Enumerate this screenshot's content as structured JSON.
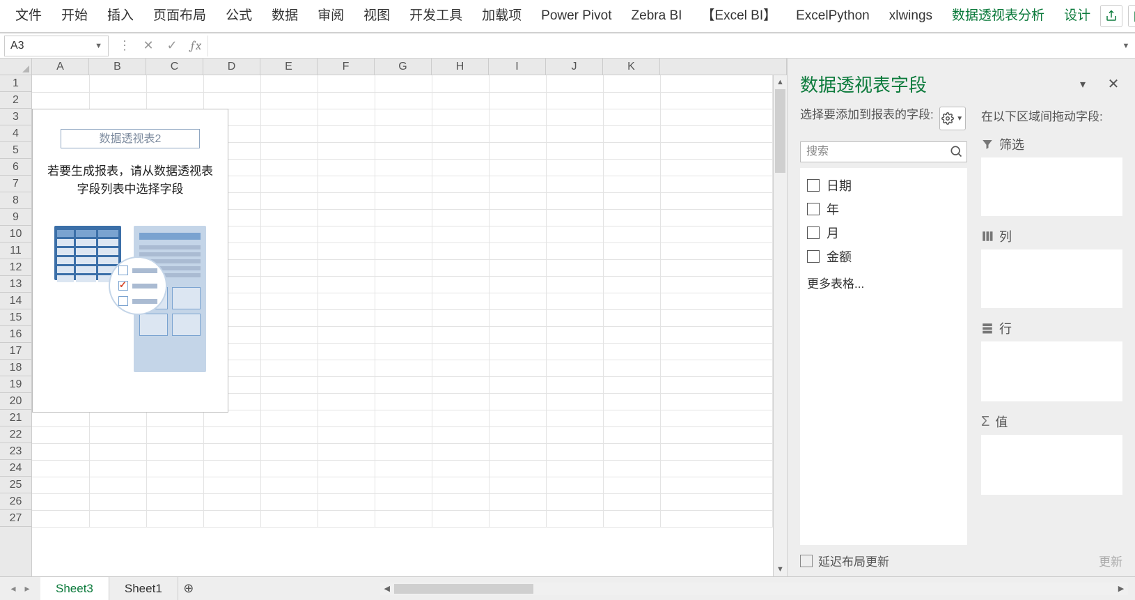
{
  "ribbon": {
    "tabs": [
      "文件",
      "开始",
      "插入",
      "页面布局",
      "公式",
      "数据",
      "审阅",
      "视图",
      "开发工具",
      "加载项",
      "Power Pivot",
      "Zebra BI",
      "【Excel BI】",
      "ExcelPython",
      "xlwings"
    ],
    "context_tabs": [
      "数据透视表分析",
      "设计"
    ]
  },
  "formula_bar": {
    "name_box": "A3",
    "value": ""
  },
  "grid": {
    "columns": [
      "A",
      "B",
      "C",
      "D",
      "E",
      "F",
      "G",
      "H",
      "I",
      "J",
      "K"
    ],
    "rows": [
      "1",
      "2",
      "3",
      "4",
      "5",
      "6",
      "7",
      "8",
      "9",
      "10",
      "11",
      "12",
      "13",
      "14",
      "15",
      "16",
      "17",
      "18",
      "19",
      "20",
      "21",
      "22",
      "23",
      "24",
      "25",
      "26",
      "27"
    ]
  },
  "pivot_placeholder": {
    "title": "数据透视表2",
    "hint_line1": "若要生成报表，请从数据透视表",
    "hint_line2": "字段列表中选择字段"
  },
  "panel": {
    "title": "数据透视表字段",
    "choose_label": "选择要添加到报表的字段:",
    "search_placeholder": "搜索",
    "fields": [
      "日期",
      "年",
      "月",
      "金额"
    ],
    "more_tables": "更多表格...",
    "drag_hint": "在以下区域间拖动字段:",
    "areas": {
      "filter": "筛选",
      "columns": "列",
      "rows": "行",
      "values": "值"
    },
    "defer_label": "延迟布局更新",
    "update_label": "更新"
  },
  "sheet_tabs": {
    "tabs": [
      "Sheet3",
      "Sheet1"
    ],
    "active": "Sheet3"
  }
}
